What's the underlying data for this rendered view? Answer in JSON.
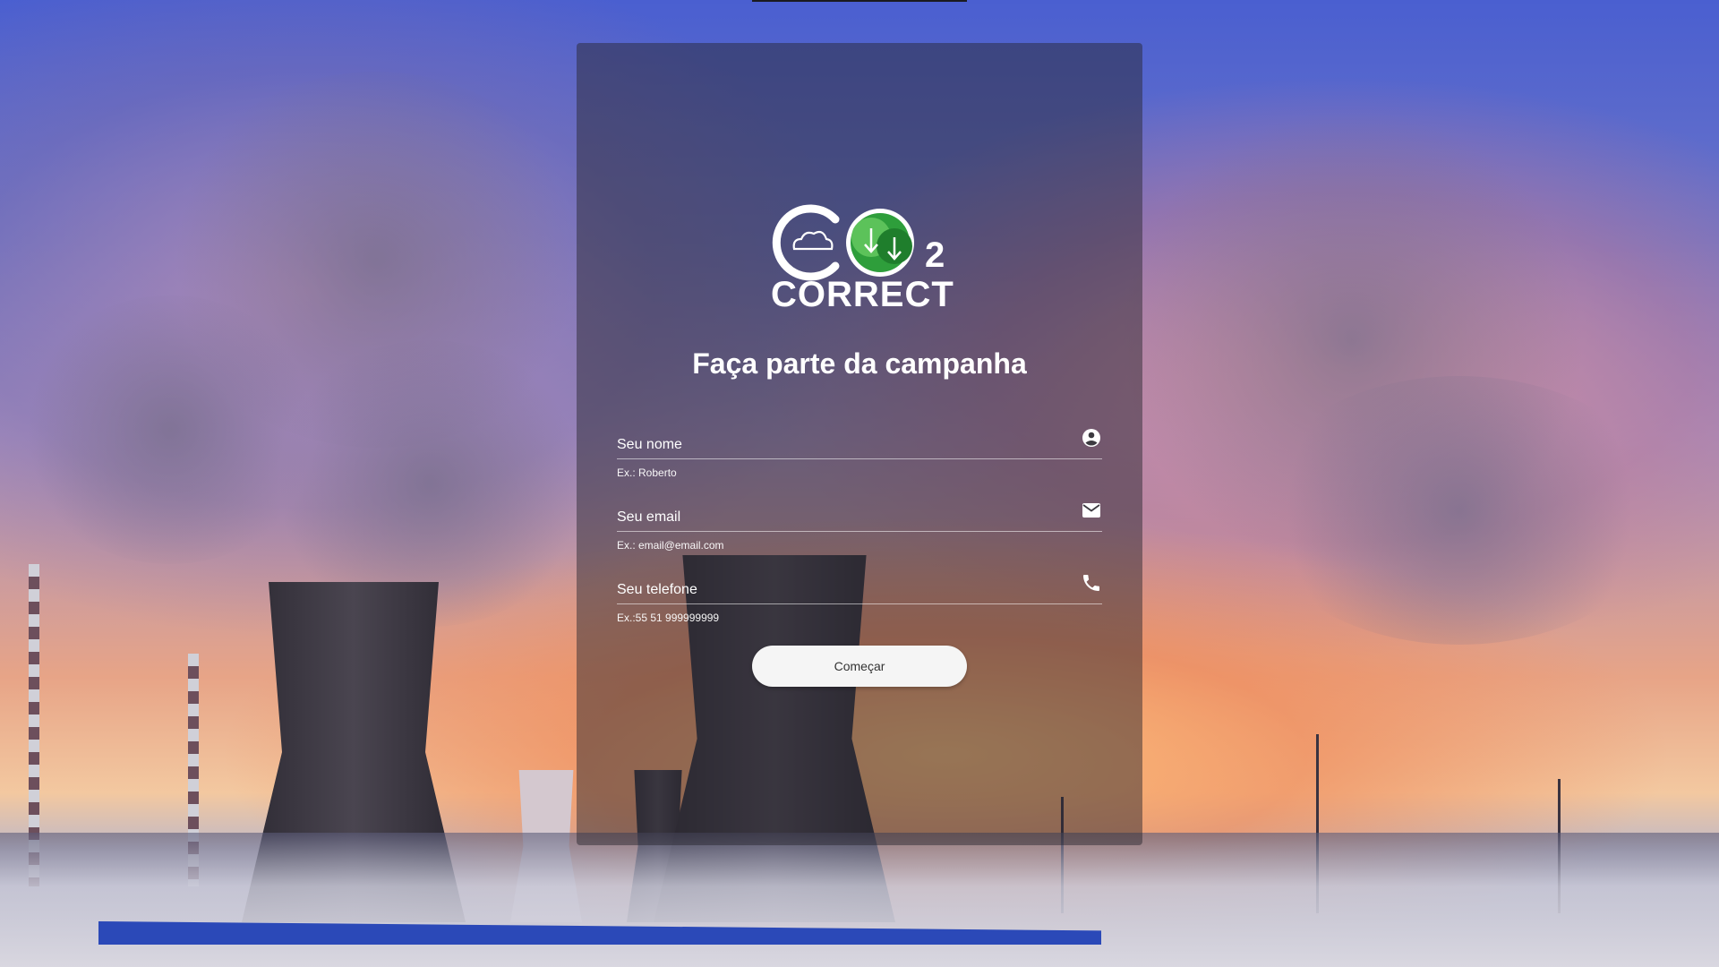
{
  "logo": {
    "text": "CO",
    "subscript": "2",
    "wordmark": "CORRECT",
    "colors": {
      "primary": "#ffffff",
      "green_dark": "#2e9e3b",
      "green_light": "#5cc25a"
    }
  },
  "form": {
    "headline": "Faça parte da campanha",
    "fields": [
      {
        "label": "Seu nome",
        "hint": "Ex.: Roberto",
        "icon": "account-circle-icon"
      },
      {
        "label": "Seu email",
        "hint": "Ex.: email@email.com",
        "icon": "mail-icon"
      },
      {
        "label": "Seu telefone",
        "hint": "Ex.:55 51 999999999",
        "icon": "phone-icon"
      }
    ],
    "submit_label": "Começar"
  }
}
